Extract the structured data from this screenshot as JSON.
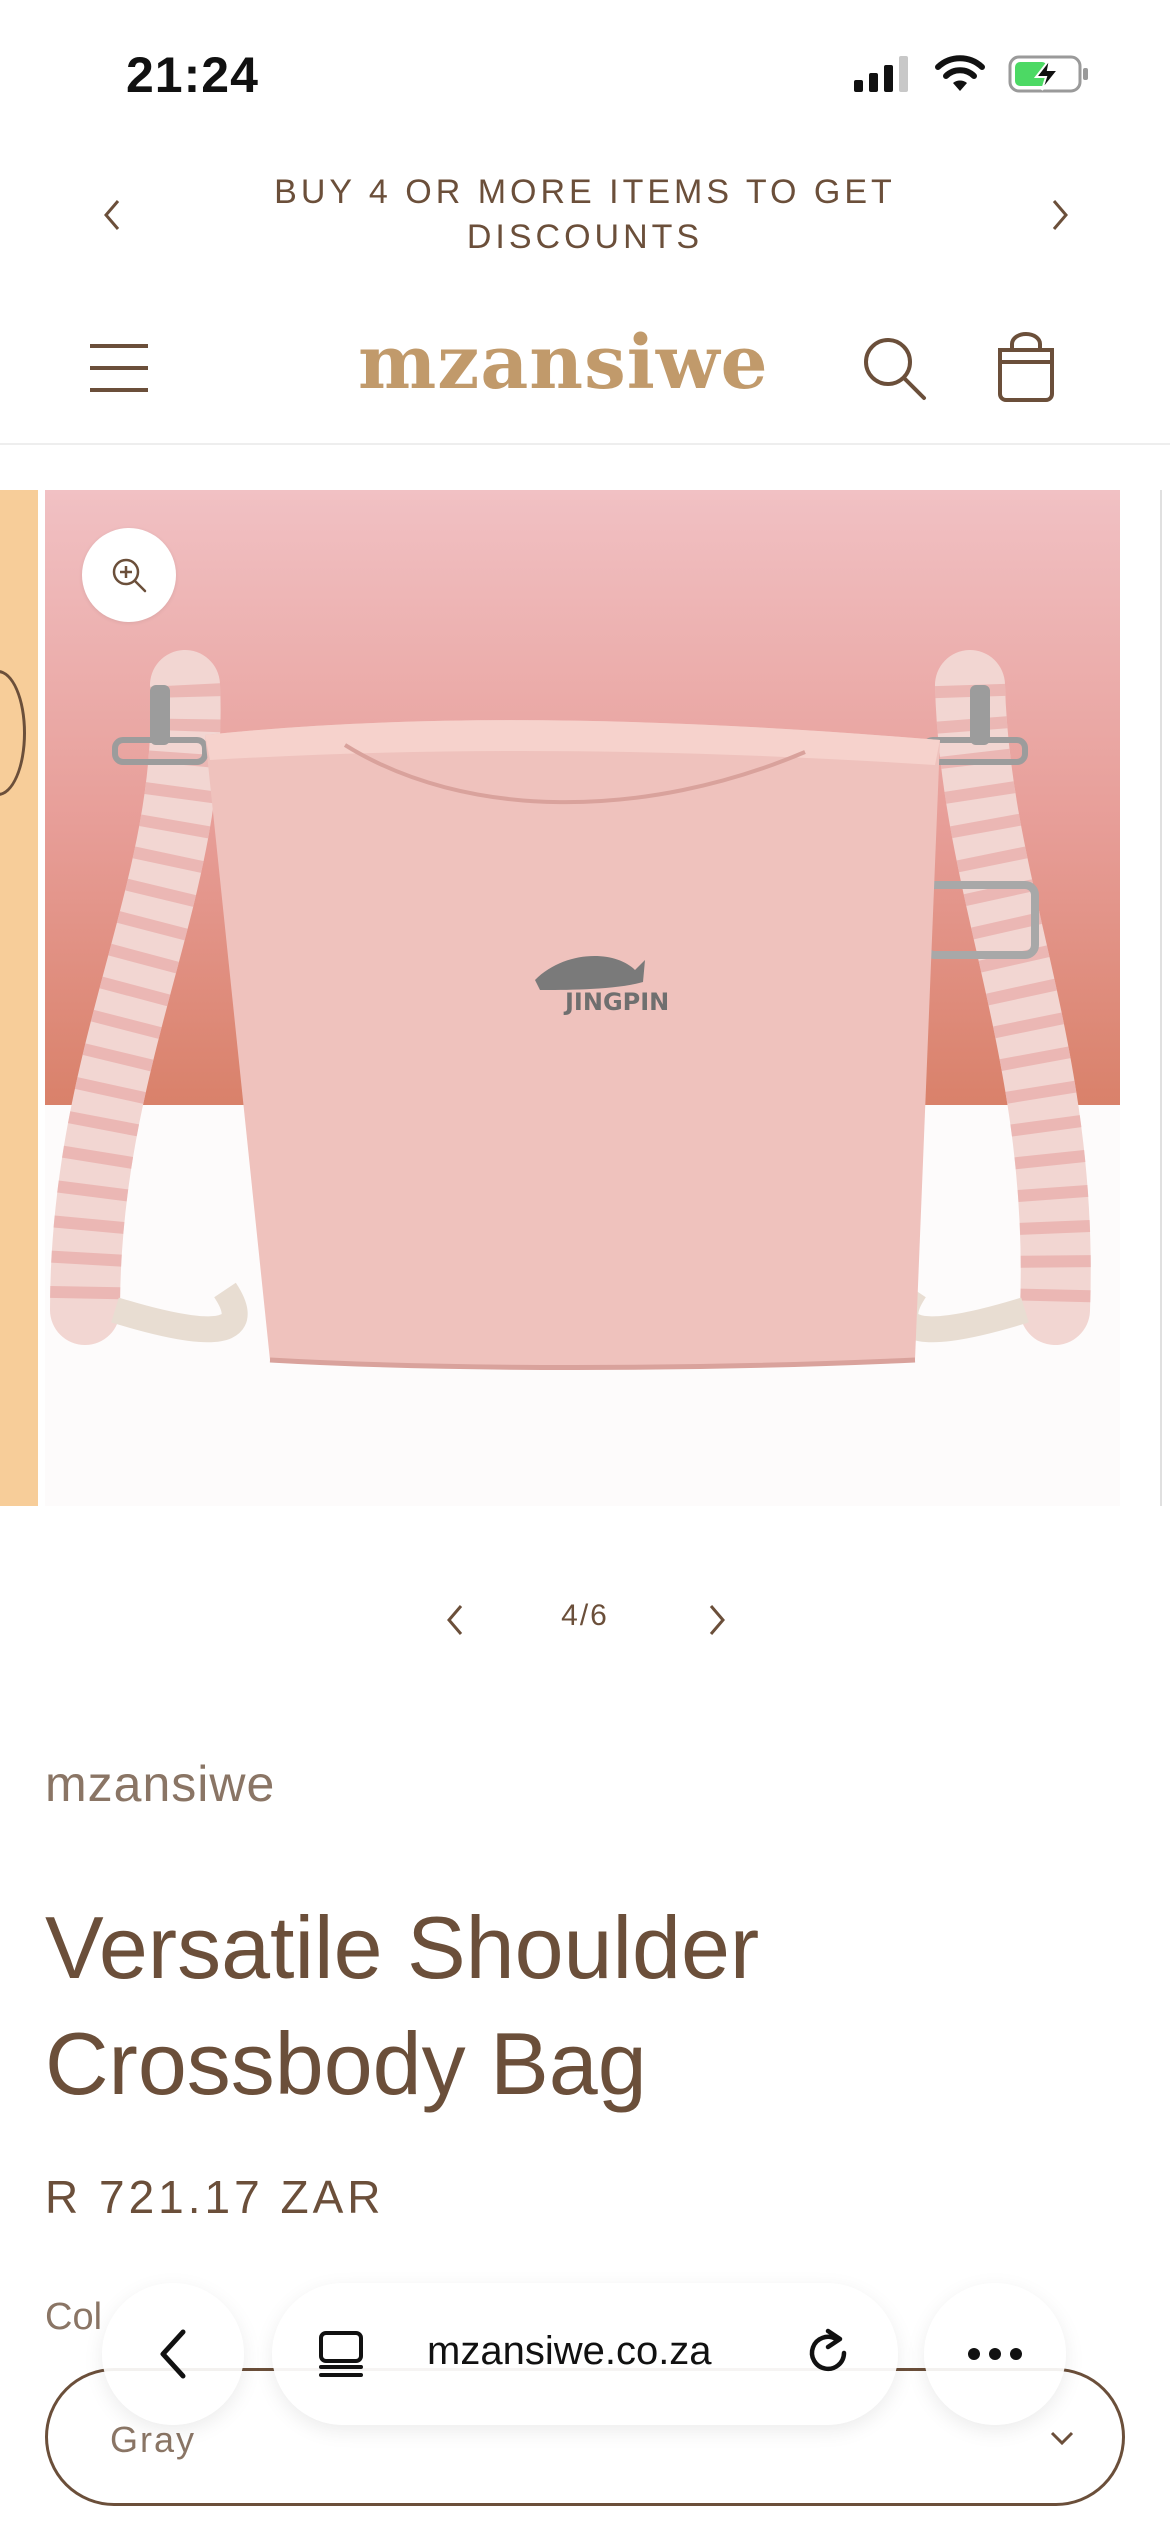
{
  "status_bar": {
    "time": "21:24",
    "icons": [
      "signal-icon",
      "wifi-icon",
      "battery-charging-icon"
    ]
  },
  "announcement": {
    "text": "BUY 4 OR MORE ITEMS TO GET DISCOUNTS",
    "prev_icon": "chevron-left-icon",
    "next_icon": "chevron-right-icon"
  },
  "header": {
    "logo": "mzansiwe",
    "icons": [
      "menu-icon",
      "search-icon",
      "cart-icon"
    ]
  },
  "gallery": {
    "zoom_icon": "zoom-in-icon",
    "product_logo": "JINGPIN",
    "counter": "4/6",
    "current_index": 4,
    "total": 6
  },
  "product": {
    "vendor": "mzansiwe",
    "title": "Versatile Shoulder Crossbody Bag",
    "price": "R 721.17 ZAR",
    "color_label": "Col",
    "color_value": "Gray"
  },
  "browser": {
    "url": "mzansiwe.co.za",
    "icons": [
      "back-icon",
      "tabs-icon",
      "reload-icon",
      "more-icon"
    ]
  },
  "colors": {
    "text_brown": "#6b4f3a",
    "logo_tan": "#c19a6b",
    "bag_pink": "#efc2bd",
    "background_gradient_top": "#f1c1c4",
    "background_gradient_bottom": "#d9816a",
    "prev_slide_peach": "#f7cd99"
  }
}
